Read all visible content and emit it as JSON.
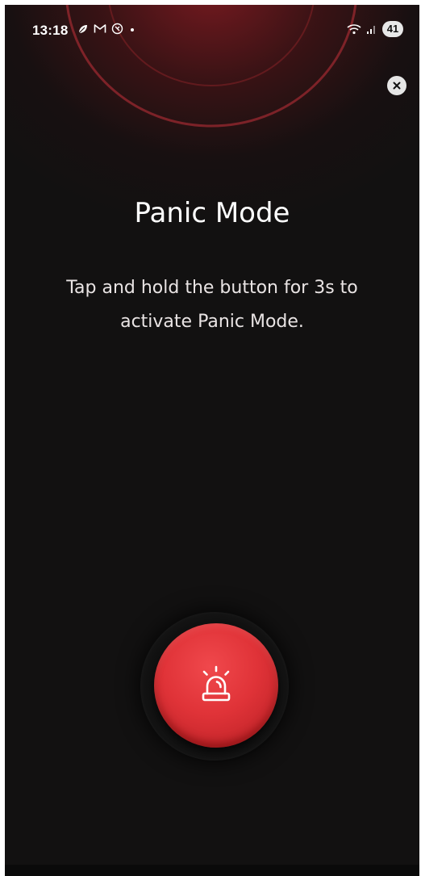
{
  "status_bar": {
    "time": "13:18",
    "notification_icons": [
      "leaf-icon",
      "gmail-icon",
      "app-icon",
      "dot-icon"
    ],
    "battery": "41"
  },
  "header": {
    "close_icon": "close-icon"
  },
  "main": {
    "title": "Panic Mode",
    "description": "Tap and hold the button for 3s to activate Panic Mode."
  },
  "panic_button": {
    "icon": "siren-icon"
  },
  "colors": {
    "background": "#121111",
    "accent": "#e03338",
    "glow": "#961c24"
  }
}
